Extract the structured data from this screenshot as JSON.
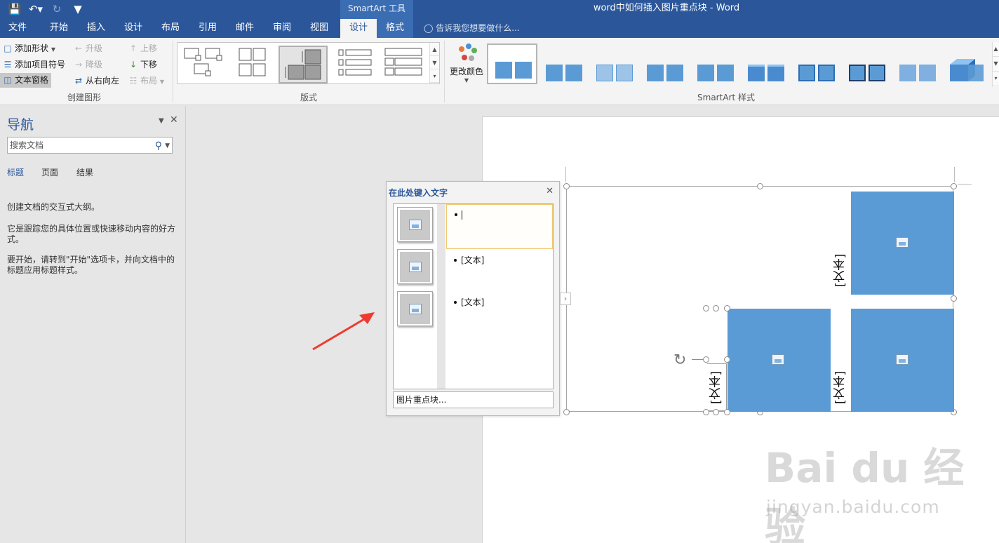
{
  "window": {
    "doc_title": "word中如何插入图片重点块 - Word",
    "context_tab_group": "SmartArt 工具"
  },
  "qat": {
    "save_icon": "save-icon",
    "undo_icon": "undo-icon",
    "redo_icon": "redo-icon",
    "customize_icon": "customize-icon"
  },
  "tabs": [
    "文件",
    "开始",
    "插入",
    "设计",
    "布局",
    "引用",
    "邮件",
    "审阅",
    "视图",
    "设计",
    "格式"
  ],
  "tell_me": "告诉我您想要做什么...",
  "ribbon": {
    "create_graphic": {
      "add_shape": "添加形状",
      "add_bullet": "添加项目符号",
      "text_pane": "文本窗格",
      "promote": "升级",
      "demote": "降级",
      "right_to_left": "从右向左",
      "move_up": "上移",
      "move_down": "下移",
      "layout": "布局",
      "label": "创建图形"
    },
    "layouts": {
      "label": "版式"
    },
    "change_colors": "更改颜色",
    "styles": {
      "label": "SmartArt 样式"
    }
  },
  "nav": {
    "title": "导航",
    "search_placeholder": "搜索文档",
    "tabs": [
      "标题",
      "页面",
      "结果"
    ],
    "text1": "创建文档的交互式大纲。",
    "text2": "它是跟踪您的具体位置或快速移动内容的好方式。",
    "text3": "要开始，请转到\"开始\"选项卡，并向文档中的标题应用标题样式。"
  },
  "text_pane": {
    "title": "在此处键入文字",
    "items": [
      "",
      "[文本]",
      "[文本]"
    ],
    "footer": "图片重点块..."
  },
  "smartart": {
    "labels": [
      "[文本]",
      "[文本]",
      "[文本]"
    ],
    "block_color": "#5b9bd5"
  },
  "watermark": {
    "main": "Bai du 经验",
    "sub": "jingyan.baidu.com"
  }
}
